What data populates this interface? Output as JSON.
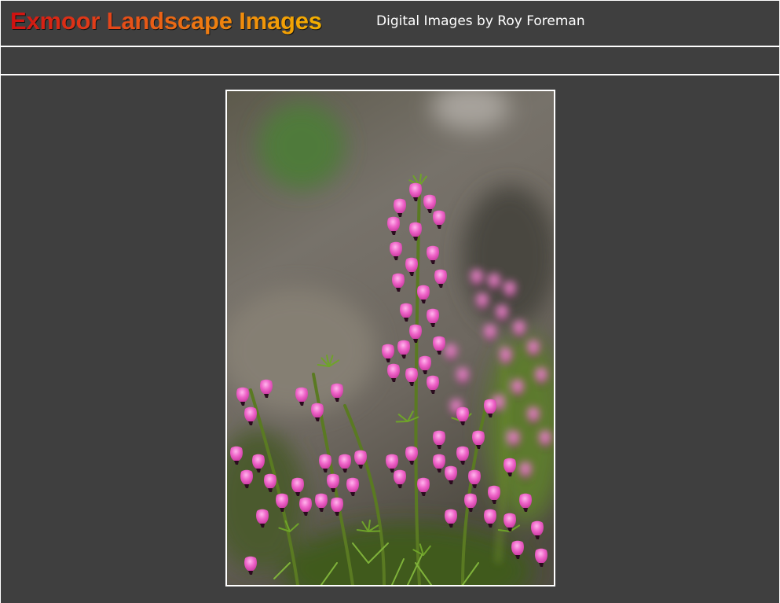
{
  "header": {
    "site_title": "Exmoor Landscape Images",
    "tagline": "Digital Images by Roy Foreman"
  },
  "photo": {
    "subject": "flower-image"
  },
  "colors": {
    "page_background": "#3f3f3f",
    "rule": "#ffffff",
    "title_gradient_start": "#d01010",
    "title_gradient_end": "#f4b100",
    "tagline_text": "#ffffff",
    "flower_pink": "#e85cc0"
  }
}
